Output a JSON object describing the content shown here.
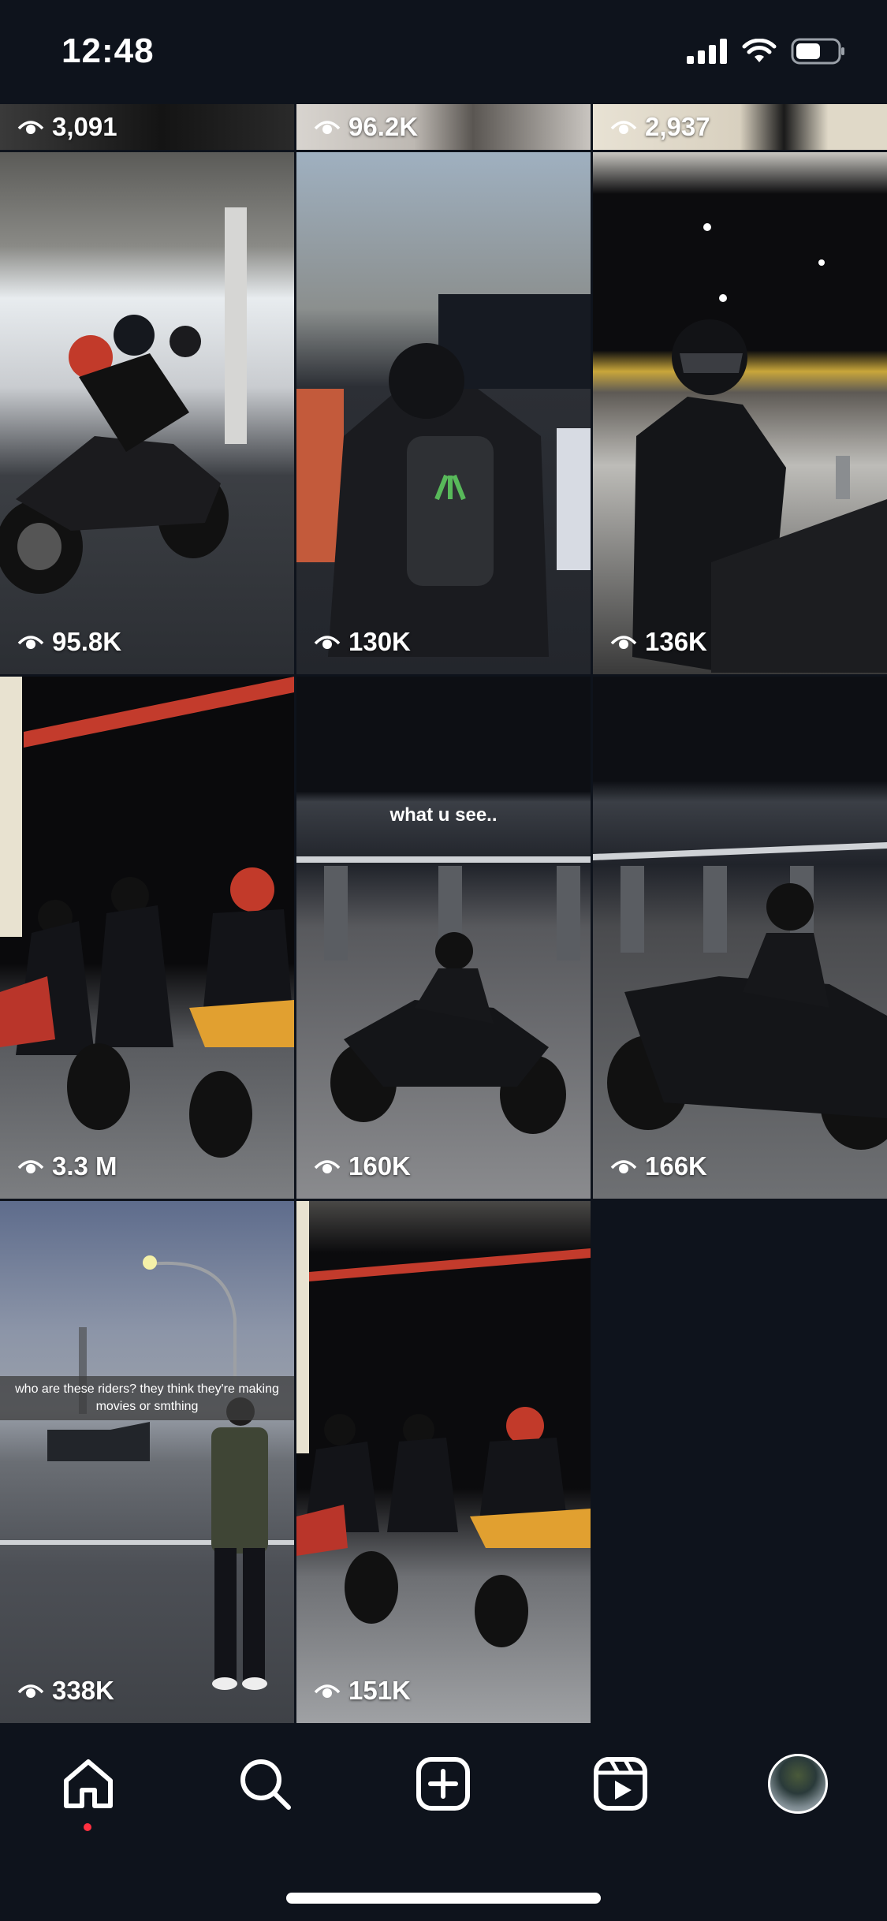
{
  "status_bar": {
    "time": "12:48"
  },
  "grid": {
    "top_row_views": [
      "3,091",
      "96.2K",
      "2,937"
    ],
    "tiles": [
      {
        "views": "95.8K"
      },
      {
        "views": "130K"
      },
      {
        "views": "136K"
      },
      {
        "views": "3.3 M"
      },
      {
        "views": "160K",
        "caption": "what u see.."
      },
      {
        "views": "166K"
      },
      {
        "views": "338K",
        "caption": "who are these riders? they think they're making movies or smthing"
      },
      {
        "views": "151K"
      }
    ]
  },
  "bottom_nav": {
    "items": [
      {
        "icon": "home-icon",
        "active": true
      },
      {
        "icon": "search-icon"
      },
      {
        "icon": "create-post-icon"
      },
      {
        "icon": "reels-icon"
      },
      {
        "icon": "profile-avatar"
      }
    ],
    "active_dot_color": "#ff3040"
  },
  "colors": {
    "background": "#0e131c",
    "text": "#ffffff"
  }
}
